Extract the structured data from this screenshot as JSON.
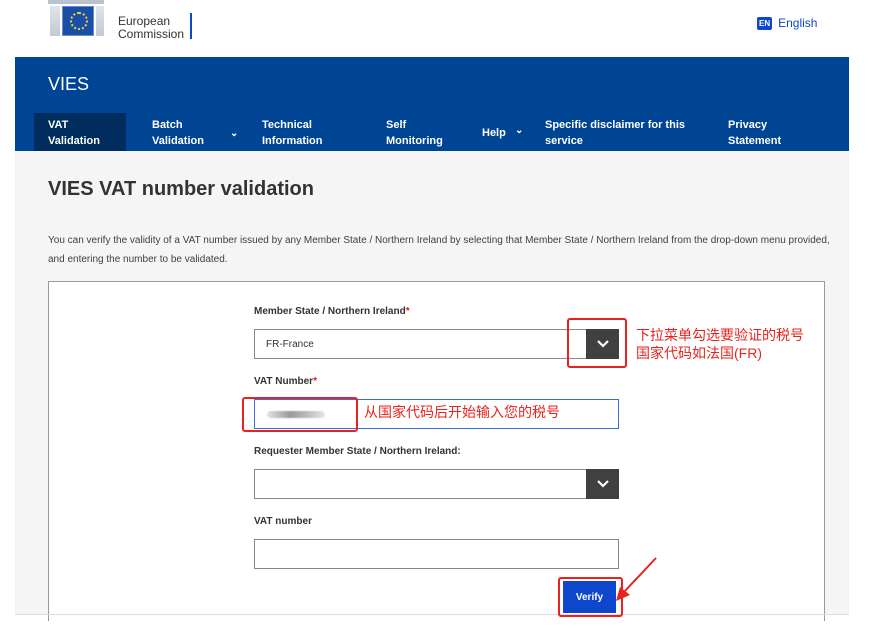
{
  "topbar": {
    "logo_line1": "European",
    "logo_line2": "Commission",
    "language_badge": "EN",
    "language_label": "English"
  },
  "header": {
    "site_title": "VIES",
    "nav": [
      {
        "line1": "VAT",
        "line2": "Validation",
        "active": true
      },
      {
        "line1": "Batch",
        "line2": "Validation",
        "has_dropdown": true
      },
      {
        "line1": "Technical",
        "line2": "Information"
      },
      {
        "line1": "Self",
        "line2": "Monitoring"
      },
      {
        "line1": "Help",
        "line2": "",
        "has_dropdown": true
      },
      {
        "line1": "Specific disclaimer for this",
        "line2": "service"
      },
      {
        "line1": "Privacy",
        "line2": "Statement"
      }
    ]
  },
  "main": {
    "title": "VIES VAT number validation",
    "intro": "You can verify the validity of a VAT number issued by any Member State / Northern Ireland by selecting that Member State / Northern Ireland from the drop-down menu provided, and entering the number to be validated."
  },
  "form": {
    "member_state_label": "Member State / Northern Ireland",
    "member_state_value": "FR-France",
    "vat_number_label": "VAT Number",
    "required_marker": "*",
    "requester_label": "Requester Member State / Northern Ireland:",
    "requester_value": "",
    "requester_vat_label": "VAT number",
    "requester_vat_value": "",
    "verify_label": "Verify"
  },
  "annotations": {
    "dropdown_note_line1": "下拉菜单勾选要验证的税号",
    "dropdown_note_line2": "国家代码如法国(FR)",
    "vat_note": "从国家代码后开始输入您的税号"
  },
  "colors": {
    "header_bg": "#004494",
    "nav_active_bg": "#002c5e",
    "primary_button": "#0e47cb",
    "annotation_red": "#e8231f"
  }
}
